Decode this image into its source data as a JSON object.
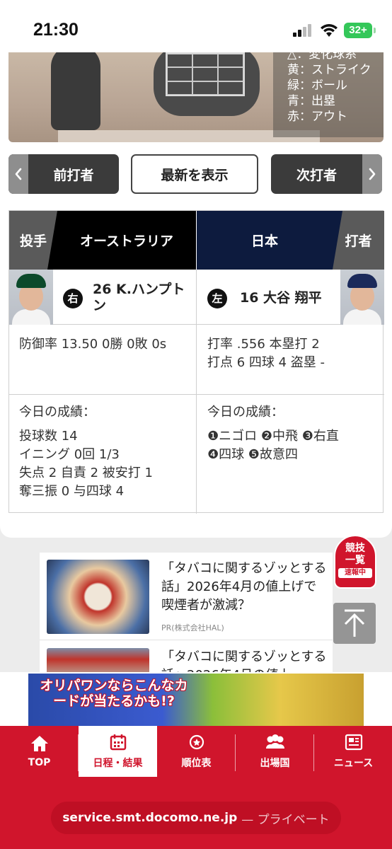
{
  "status_bar": {
    "time": "21:30",
    "battery": "32+"
  },
  "legend": [
    "△：変化球系",
    "黄：ストライク",
    "緑：ボール",
    "青：出塁",
    "赤：アウト"
  ],
  "nav": {
    "prev": "前打者",
    "latest": "最新を表示",
    "next": "次打者"
  },
  "matchup": {
    "pitcher_role": "投手",
    "pitcher_team": "オーストラリア",
    "batter_team": "日本",
    "batter_role": "打者",
    "pitcher": {
      "hand": "右",
      "name": "26 K.ハンプトン",
      "stats": "防御率 13.50 0勝 0敗 0s",
      "today_title": "今日の成績：",
      "today_lines": [
        "投球数 14",
        "イニング 0回 1/3",
        "失点 2 自責 2 被安打 1",
        "奪三振 0 与四球 4"
      ]
    },
    "batter": {
      "hand": "左",
      "name": "16 大谷 翔平",
      "stats_line1": "打率 .556 本塁打 2",
      "stats_line2": "打点 6 四球 4 盗塁 -",
      "today_title": "今日の成績：",
      "today_lines": [
        "❶ニゴロ ❷中飛 ❸右直",
        "❹四球 ❺故意四"
      ]
    }
  },
  "articles": [
    {
      "title": "「タバコに関するゾッとする話」2026年4月の値上げで喫煙者が激減？",
      "pr": "PR(株式会社HAL)"
    },
    {
      "title": "「タバコに関するゾッとする話」2026年4月の値上",
      "pr": ""
    }
  ],
  "badge": {
    "line1": "競技",
    "line2": "一覧",
    "line3": "速報中"
  },
  "ad": {
    "text": "オリパワンならこんなカードが当たるかも!?"
  },
  "tabs": [
    {
      "label": "TOP",
      "icon": "home-icon"
    },
    {
      "label": "日程・結果",
      "icon": "calendar-icon"
    },
    {
      "label": "順位表",
      "icon": "medal-icon"
    },
    {
      "label": "出場国",
      "icon": "people-icon"
    },
    {
      "label": "ニュース",
      "icon": "newspaper-icon"
    }
  ],
  "url": {
    "domain": "service.smt.docomo.ne.jp",
    "mode": "— プライベート"
  },
  "colors": {
    "accent": "#d0152c",
    "pitcher_header": "#000000",
    "batter_header": "#0d1b3e"
  }
}
